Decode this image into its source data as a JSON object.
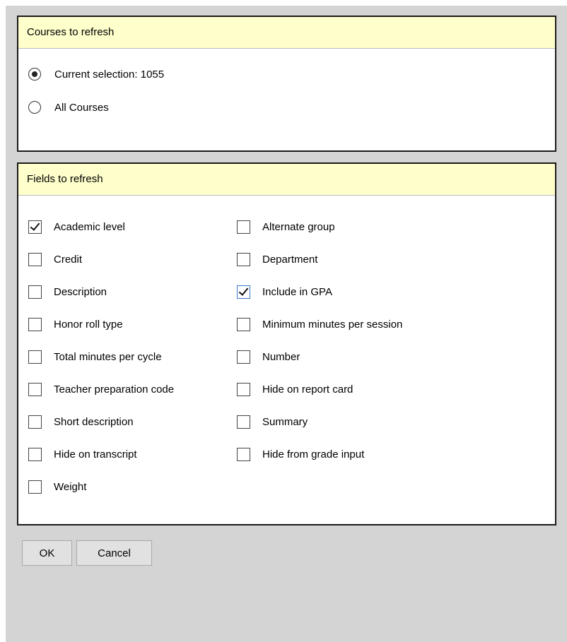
{
  "courses": {
    "header": "Courses to refresh",
    "options": [
      {
        "label": "Current selection: 1055",
        "selected": true
      },
      {
        "label": "All Courses",
        "selected": false
      }
    ]
  },
  "fields": {
    "header": "Fields to refresh",
    "left": [
      {
        "label": "Academic level",
        "checked": true
      },
      {
        "label": "Credit",
        "checked": false
      },
      {
        "label": "Description",
        "checked": false
      },
      {
        "label": "Honor roll type",
        "checked": false
      },
      {
        "label": "Total minutes per cycle",
        "checked": false
      },
      {
        "label": "Teacher preparation code",
        "checked": false
      },
      {
        "label": "Short description",
        "checked": false
      },
      {
        "label": "Hide on transcript",
        "checked": false
      },
      {
        "label": "Weight",
        "checked": false
      }
    ],
    "right": [
      {
        "label": "Alternate group",
        "checked": false
      },
      {
        "label": "Department",
        "checked": false
      },
      {
        "label": "Include in GPA",
        "checked": true,
        "focused": true
      },
      {
        "label": "Minimum minutes per session",
        "checked": false
      },
      {
        "label": "Number",
        "checked": false
      },
      {
        "label": "Hide on report card",
        "checked": false
      },
      {
        "label": "Summary",
        "checked": false
      },
      {
        "label": "Hide from grade input",
        "checked": false
      }
    ]
  },
  "buttons": {
    "ok": "OK",
    "cancel": "Cancel"
  },
  "colors": {
    "panel_header_bg": "#ffffcc",
    "background": "#d4d4d4"
  }
}
